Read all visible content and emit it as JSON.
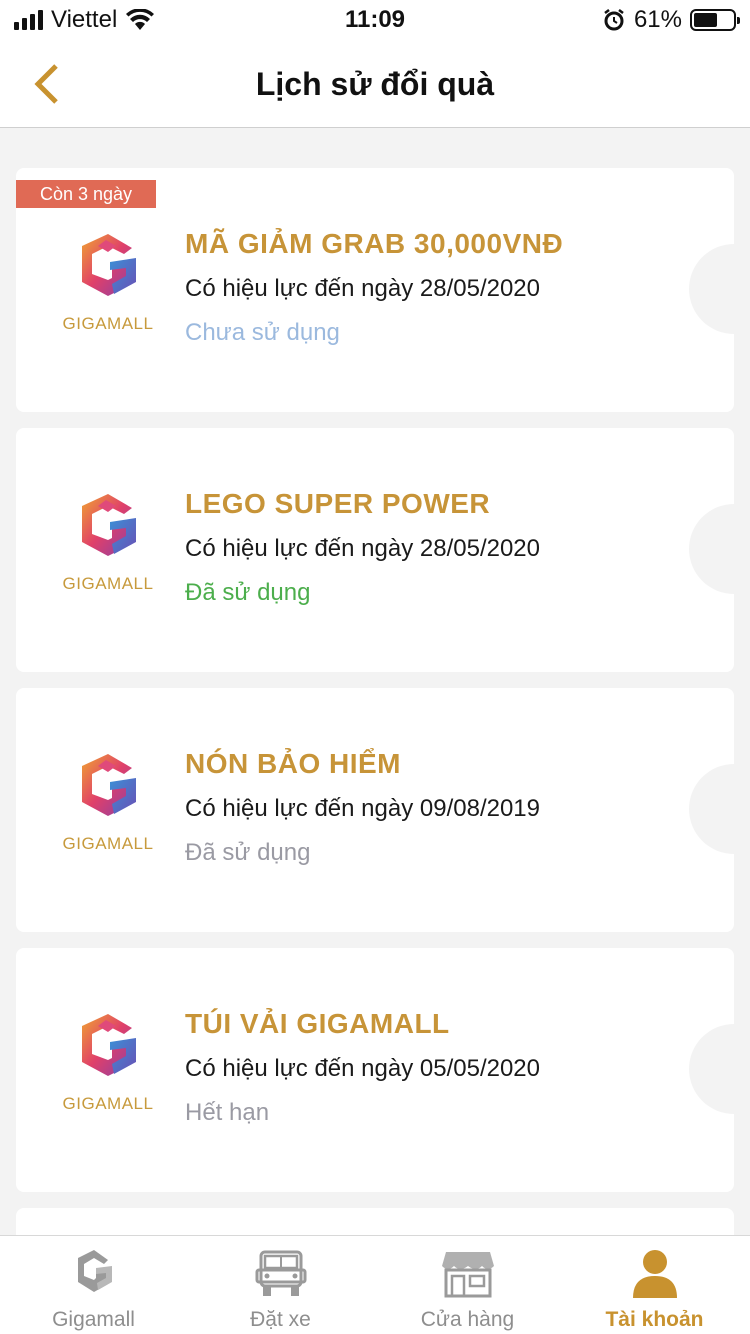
{
  "status_bar": {
    "carrier": "Viettel",
    "time": "11:09",
    "battery_percent": "61%",
    "battery_level": 0.61,
    "icons": [
      "signal-icon",
      "wifi-icon",
      "alarm-icon",
      "battery-icon"
    ]
  },
  "header": {
    "title": "Lịch sử đổi quà",
    "back_icon": "chevron-left-icon"
  },
  "colors": {
    "accent": "#c8922f",
    "title_gold": "#c79438",
    "badge": "#e06a55",
    "status_unused": "#9bb9de",
    "status_used_green": "#4cae4c",
    "status_gray": "#9a9aa3"
  },
  "rewards": [
    {
      "badge": "Còn 3 ngày",
      "logo_text": "GIGAMALL",
      "title": "MÃ GIẢM GRAB 30,000VNĐ",
      "validity": "Có hiệu lực đến ngày 28/05/2020",
      "status": "Chưa sử dụng"
    },
    {
      "logo_text": "GIGAMALL",
      "title": "LEGO SUPER POWER",
      "validity": "Có hiệu lực đến ngày 28/05/2020",
      "status": "Đã sử dụng"
    },
    {
      "logo_text": "GIGAMALL",
      "title": "NÓN BẢO HIỂM",
      "validity": "Có hiệu lực đến ngày 09/08/2019",
      "status": "Đã sử dụng"
    },
    {
      "logo_text": "GIGAMALL",
      "title": "TÚI VẢI GIGAMALL",
      "validity": "Có hiệu lực đến ngày 05/05/2020",
      "status": "Hết hạn"
    }
  ],
  "tab_bar": {
    "tabs": [
      {
        "label": "Gigamall",
        "icon": "gigamall-logo-icon"
      },
      {
        "label": "Đặt xe",
        "icon": "car-icon"
      },
      {
        "label": "Cửa hàng",
        "icon": "store-icon"
      },
      {
        "label": "Tài khoản",
        "icon": "user-icon"
      }
    ],
    "active": "Tài khoản"
  }
}
